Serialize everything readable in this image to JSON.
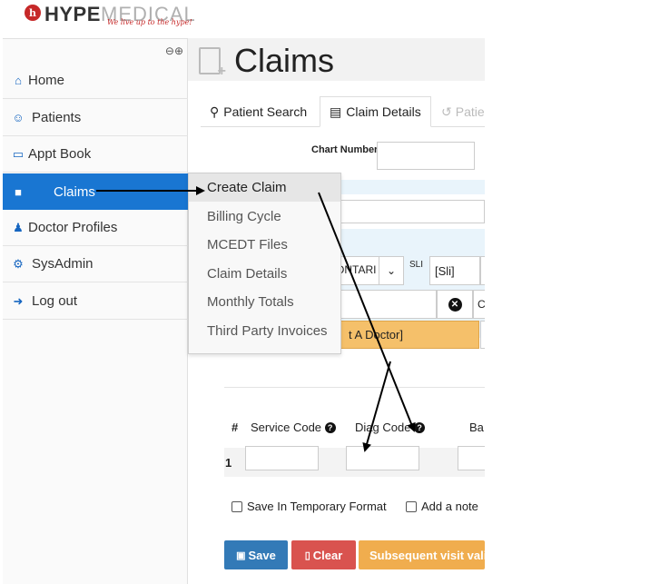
{
  "brand": {
    "logo_letter": "h",
    "name_part1": "HYPE",
    "name_part2": "MEDICAL",
    "tagline": "We live up to the hype!"
  },
  "sidebar": {
    "collapse_icons": "⊖⊕",
    "items": [
      {
        "label": "Home",
        "icon": "home-icon"
      },
      {
        "label": "Patients",
        "icon": "users-icon"
      },
      {
        "label": "Appt Book",
        "icon": "book-icon"
      },
      {
        "label": "Claims",
        "icon": "briefcase-icon",
        "active": true
      },
      {
        "label": "Doctor Profiles",
        "icon": "user-md-icon"
      },
      {
        "label": "SysAdmin",
        "icon": "gear-icon"
      },
      {
        "label": "Log out",
        "icon": "sign-out-icon"
      }
    ]
  },
  "claims_menu": {
    "items": [
      "Create Claim",
      "Billing Cycle",
      "MCEDT Files",
      "Claim Details",
      "Monthly Totals",
      "Third Party Invoices"
    ]
  },
  "page": {
    "title": "Claims",
    "tabs": [
      "Patient Search",
      "Claim Details",
      "Patie"
    ],
    "chart_number_label": "Chart Number",
    "province_value": "ONTARI",
    "sli_label": "SLI",
    "sli_value": "[Sli]",
    "doctor_value": "t A Doctor]",
    "clear_right_glyph": "C"
  },
  "table": {
    "headers": {
      "num": "#",
      "service_code": "Service Code",
      "diag_code": "Diag Code",
      "ba": "Ba"
    },
    "row_number": "1"
  },
  "options": {
    "save_temp": "Save In Temporary Format",
    "add_note": "Add a note"
  },
  "buttons": {
    "save": "Save",
    "clear": "Clear",
    "subsequent": "Subsequent visit valid"
  },
  "colors": {
    "active_nav": "#1976d2",
    "save": "#337ab7",
    "clear": "#d9534f",
    "subsequent": "#f0ad4e",
    "doctor_field": "#f5c06a"
  }
}
